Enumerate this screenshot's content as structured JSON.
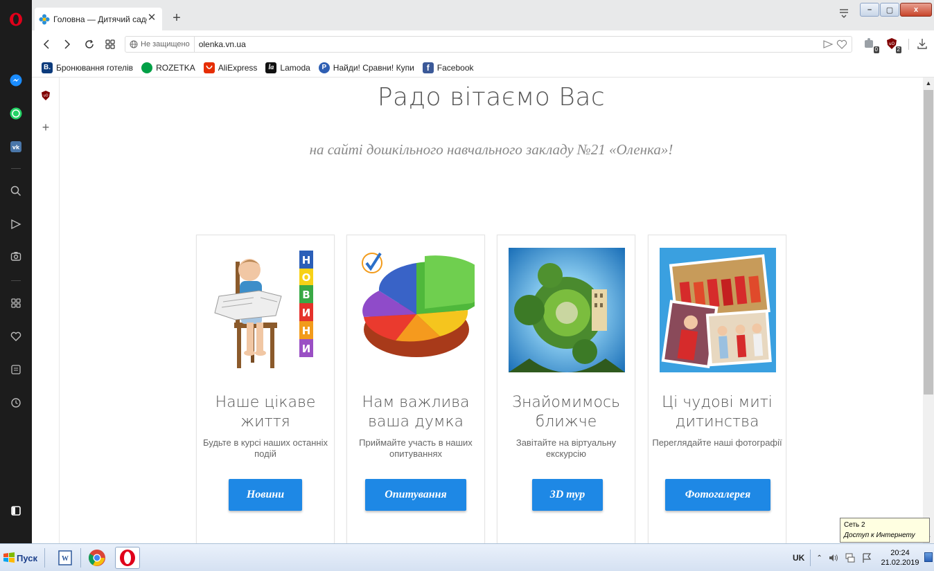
{
  "browser": {
    "tab": {
      "title": "Головна — Дитячий садо",
      "close_glyph": "✕"
    },
    "new_tab_glyph": "+",
    "window_controls": {
      "minimize": "–",
      "maximize": "▢",
      "close": "x"
    }
  },
  "address_bar": {
    "security_label": "Не защищено",
    "url": "olenka.vn.ua",
    "extension_badges": [
      "0",
      "2"
    ]
  },
  "bookmarks": [
    {
      "label": "Бронювання готелів",
      "icon": "booking-icon",
      "glyph": "B.",
      "color": "#0c3b7c"
    },
    {
      "label": "ROZETKA",
      "icon": "rozetka-icon",
      "glyph": "",
      "color": "#00a046"
    },
    {
      "label": "AliExpress",
      "icon": "aliexpress-icon",
      "glyph": "",
      "color": "#e62e04"
    },
    {
      "label": "Lamoda",
      "icon": "lamoda-icon",
      "glyph": "la",
      "color": "#111111"
    },
    {
      "label": "Найди! Сравни! Купи",
      "icon": "price-icon",
      "glyph": "P",
      "color": "#2f5fb3"
    },
    {
      "label": "Facebook",
      "icon": "facebook-icon",
      "glyph": "f",
      "color": "#3b5998"
    }
  ],
  "page": {
    "title": "Радо вітаємо Вас",
    "subtitle": "на сайті дошкільного навчального закладу №21 «Оленка»!",
    "cards": [
      {
        "title": "Наше цікаве життя",
        "desc": "Будьте в курсі наших останніх подій",
        "button": "Новини",
        "image": "news-boy-image"
      },
      {
        "title": "Нам важлива ваша думка",
        "desc": "Приймайте участь в наших опитуваннях",
        "button": "Опитування",
        "image": "pie-chart-image"
      },
      {
        "title": "Знайомимось ближче",
        "desc": "Завітайте на віртуальну екскурсію",
        "button": "3D тур",
        "image": "panorama-image"
      },
      {
        "title": "Ці чудові миті дитинства",
        "desc": "Переглядайте наші фотографії",
        "button": "Фотогалерея",
        "image": "photo-gallery-image"
      }
    ],
    "news_letters": [
      "Н",
      "О",
      "В",
      "И",
      "Н",
      "И"
    ]
  },
  "tooltip": {
    "line1": "Сеть 2",
    "line2": "Доступ к Интернету"
  },
  "taskbar": {
    "start_label": "Пуск",
    "language": "UK",
    "time": "20:24",
    "date": "21.02.2019"
  },
  "colors": {
    "accent_button": "#1e88e5",
    "sidebar_bg": "#1c1c1c",
    "opera_red": "#e0001a"
  }
}
